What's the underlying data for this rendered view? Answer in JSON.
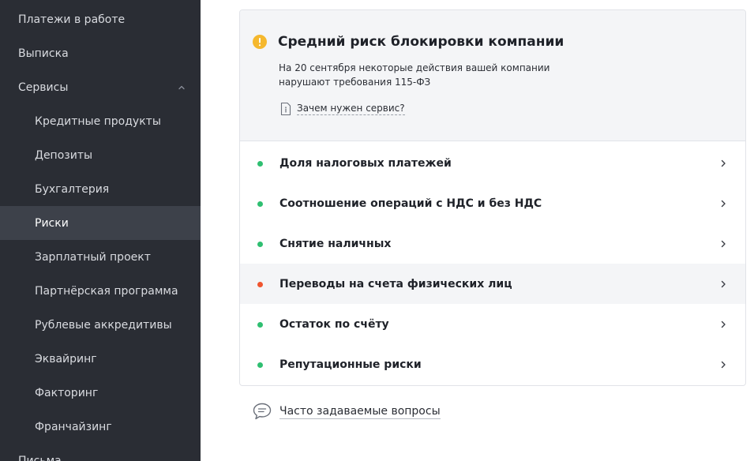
{
  "sidebar": {
    "items": [
      {
        "label": "Платежи в работе",
        "level": "top",
        "active": false
      },
      {
        "label": "Выписка",
        "level": "top",
        "active": false
      },
      {
        "label": "Сервисы",
        "level": "top",
        "active": false,
        "expanded": true
      },
      {
        "label": "Кредитные продукты",
        "level": "sub",
        "active": false
      },
      {
        "label": "Депозиты",
        "level": "sub",
        "active": false
      },
      {
        "label": "Бухгалтерия",
        "level": "sub",
        "active": false
      },
      {
        "label": "Риски",
        "level": "sub",
        "active": true
      },
      {
        "label": "Зарплатный проект",
        "level": "sub",
        "active": false
      },
      {
        "label": "Партнёрская программа",
        "level": "sub",
        "active": false
      },
      {
        "label": "Рублевые аккредитивы",
        "level": "sub",
        "active": false
      },
      {
        "label": "Эквайринг",
        "level": "sub",
        "active": false
      },
      {
        "label": "Факторинг",
        "level": "sub",
        "active": false
      },
      {
        "label": "Франчайзинг",
        "level": "sub",
        "active": false
      },
      {
        "label": "Письма",
        "level": "top",
        "active": false
      }
    ]
  },
  "risk": {
    "title": "Средний риск блокировки компании",
    "description": "На 20 сентября некоторые действия вашей компании нарушают требования 115-ФЗ",
    "why_link": "Зачем нужен сервис?",
    "rows": [
      {
        "label": "Доля налоговых платежей",
        "status": "ok"
      },
      {
        "label": "Соотношение операций с НДС и без НДС",
        "status": "ok"
      },
      {
        "label": "Снятие наличных",
        "status": "ok"
      },
      {
        "label": "Переводы на счета физических лиц",
        "status": "warning"
      },
      {
        "label": "Остаток по счёту",
        "status": "ok"
      },
      {
        "label": "Репутационные риски",
        "status": "ok"
      }
    ]
  },
  "faq": {
    "label": "Часто задаваемые вопросы"
  },
  "colors": {
    "sidebar_bg": "#2a2d34",
    "sidebar_active": "#3d414a",
    "status_ok": "#2fbf71",
    "status_warning": "#f0552f",
    "warning_icon": "#f5b82e"
  },
  "icons": {
    "warning": "warning-circle-icon",
    "doc": "document-icon",
    "faq": "chat-bubble-icon",
    "chevron_right": "chevron-right-icon",
    "chevron_up": "chevron-up-icon"
  }
}
